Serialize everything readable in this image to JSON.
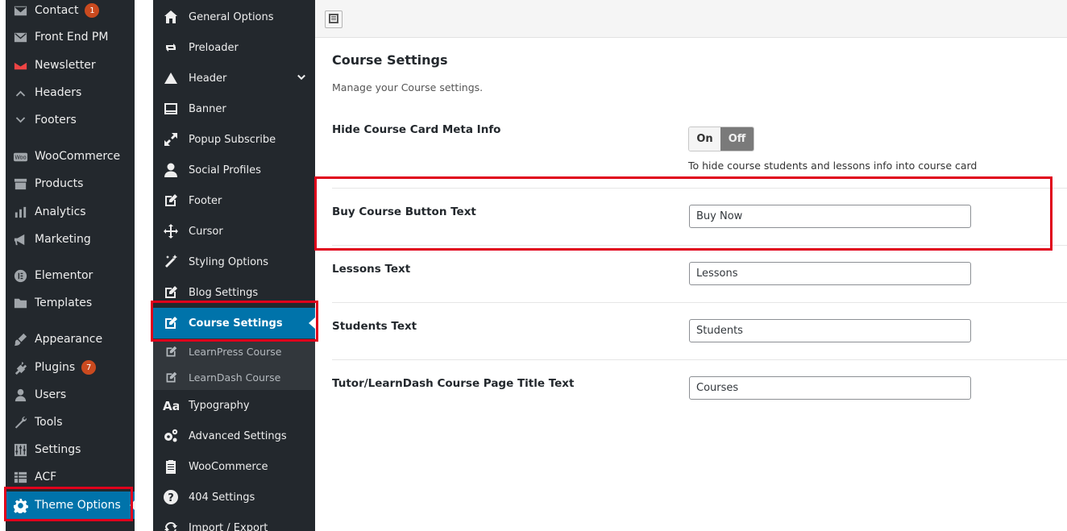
{
  "wp_menu": {
    "items": [
      {
        "label": "Contact",
        "icon": "mail-icon",
        "badge": "1"
      },
      {
        "label": "Front End PM",
        "icon": "mail-icon"
      },
      {
        "label": "Newsletter",
        "icon": "newsletter-icon"
      },
      {
        "label": "Headers",
        "icon": "chevron-up-icon"
      },
      {
        "label": "Footers",
        "icon": "chevron-down-icon"
      },
      {
        "label": "WooCommerce",
        "icon": "woo-icon"
      },
      {
        "label": "Products",
        "icon": "archive-icon"
      },
      {
        "label": "Analytics",
        "icon": "chart-bar-icon"
      },
      {
        "label": "Marketing",
        "icon": "megaphone-icon"
      },
      {
        "label": "Elementor",
        "icon": "elementor-icon"
      },
      {
        "label": "Templates",
        "icon": "folder-icon"
      },
      {
        "label": "Appearance",
        "icon": "brush-icon"
      },
      {
        "label": "Plugins",
        "icon": "plugin-icon",
        "badge": "7"
      },
      {
        "label": "Users",
        "icon": "user-icon"
      },
      {
        "label": "Tools",
        "icon": "wrench-icon"
      },
      {
        "label": "Settings",
        "icon": "sliders-icon"
      },
      {
        "label": "ACF",
        "icon": "grid-icon"
      },
      {
        "label": "Theme Options",
        "icon": "gear-icon",
        "active": true
      }
    ]
  },
  "theme_menu": {
    "items": [
      {
        "label": "General Options",
        "icon": "home-icon"
      },
      {
        "label": "Preloader",
        "icon": "loop-icon"
      },
      {
        "label": "Header",
        "icon": "triangle-icon",
        "expandable": true
      },
      {
        "label": "Banner",
        "icon": "banner-icon"
      },
      {
        "label": "Popup Subscribe",
        "icon": "expand-icon"
      },
      {
        "label": "Social Profiles",
        "icon": "person-icon"
      },
      {
        "label": "Footer",
        "icon": "edit-icon"
      },
      {
        "label": "Cursor",
        "icon": "move-icon"
      },
      {
        "label": "Styling Options",
        "icon": "magic-wand-icon"
      },
      {
        "label": "Blog Settings",
        "icon": "edit-icon"
      },
      {
        "label": "Course Settings",
        "icon": "edit-icon",
        "active": true
      },
      {
        "label": "LearnPress Course",
        "icon": "edit-icon",
        "sub": true
      },
      {
        "label": "LearnDash Course",
        "icon": "edit-icon",
        "sub": true
      },
      {
        "label": "Typography",
        "icon": "typography-icon"
      },
      {
        "label": "Advanced Settings",
        "icon": "cogs-icon"
      },
      {
        "label": "WooCommerce",
        "icon": "clipboard-icon"
      },
      {
        "label": "404 Settings",
        "icon": "question-icon"
      },
      {
        "label": "Import / Export",
        "icon": "refresh-icon"
      }
    ]
  },
  "section": {
    "title": "Course Settings",
    "description": "Manage your Course settings."
  },
  "fields": {
    "hide_meta": {
      "label": "Hide Course Card Meta Info",
      "on_label": "On",
      "off_label": "Off",
      "selected": "Off",
      "description": "To hide course students and lessons info into course card"
    },
    "buy_button": {
      "label": "Buy Course Button Text",
      "value": "Buy Now"
    },
    "lessons": {
      "label": "Lessons Text",
      "value": "Lessons"
    },
    "students": {
      "label": "Students Text",
      "value": "Students"
    },
    "page_title": {
      "label": "Tutor/LearnDash Course Page Title Text",
      "value": "Courses"
    }
  },
  "colors": {
    "sidebar_bg": "#23282d",
    "active_blue": "#0073aa",
    "highlight_red": "#e0001b",
    "badge": "#ca4a1f"
  }
}
